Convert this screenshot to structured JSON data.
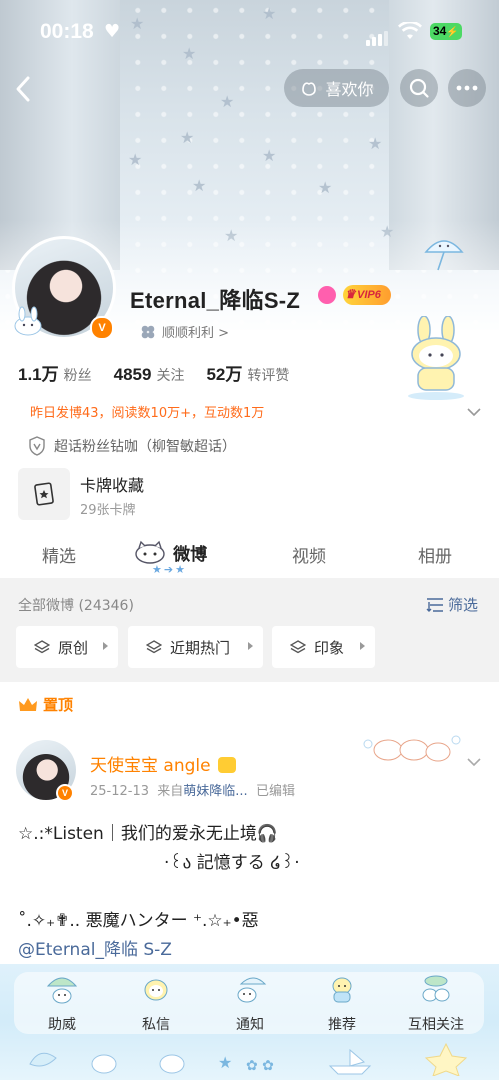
{
  "status": {
    "time": "00:18",
    "battery": "34"
  },
  "header": {
    "like_label": "喜欢你"
  },
  "profile": {
    "name": "Eternal_降临S-Z",
    "vip_label": "VIP6",
    "sub_label": "顺顺利利 >",
    "stats": [
      {
        "num": "1.1万",
        "label": "粉丝"
      },
      {
        "num": "4859",
        "label": "关注"
      },
      {
        "num": "52万",
        "label": "转评赞"
      }
    ],
    "activity": "昨日发博43，阅读数10万+，互动数1万",
    "fan_club": "超话粉丝钻咖（柳智敏超话）",
    "card": {
      "title": "卡牌收藏",
      "sub": "29张卡牌"
    }
  },
  "tabs": [
    {
      "label": "精选"
    },
    {
      "label": "微博"
    },
    {
      "label": "视频"
    },
    {
      "label": "相册"
    }
  ],
  "filter": {
    "all_label": "全部微博 (24346)",
    "filter_label": "筛选",
    "chips": [
      {
        "label": "原创"
      },
      {
        "label": "近期热门"
      },
      {
        "label": "印象"
      }
    ]
  },
  "post": {
    "pinned_label": "置顶",
    "author": "天使宝宝 angle",
    "date": "25-12-13",
    "source_prefix": "来自",
    "source": "萌妹降临...",
    "edited": "已编辑",
    "line1": "☆.:*Listen｜我们的爱永无止境🎧",
    "line2": "·꒰ა 記憶する ໒꒱·",
    "line3": "˚.✧₊✟.. 悪魔ハンター ⁺.☆₊•惡",
    "mention": "@Eternal_降临 S-Z"
  },
  "bottom_nav": [
    {
      "label": "助威"
    },
    {
      "label": "私信"
    },
    {
      "label": "通知"
    },
    {
      "label": "推荐"
    },
    {
      "label": "互相关注"
    }
  ],
  "colors": {
    "accent": "#ff8200",
    "link": "#4a6a9a",
    "activity": "#ff6b1a"
  }
}
